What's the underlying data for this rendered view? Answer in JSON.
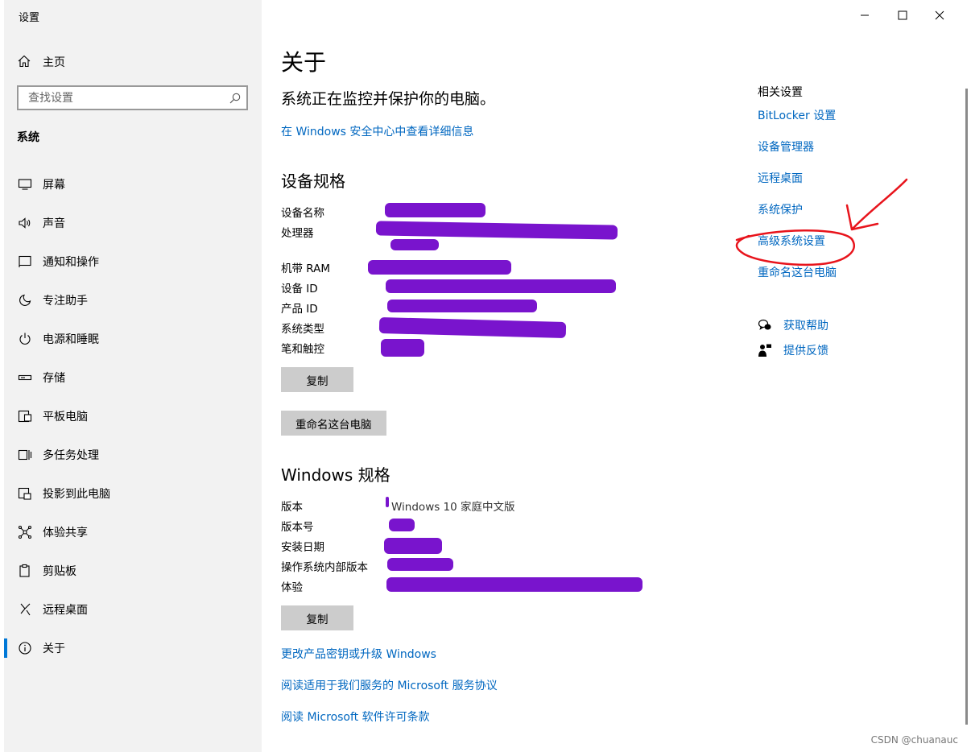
{
  "window": {
    "title": "设置"
  },
  "sidebar": {
    "home_label": "主页",
    "search_placeholder": "查找设置",
    "section_title": "系统",
    "items": [
      {
        "label": "屏幕",
        "icon": "display-icon"
      },
      {
        "label": "声音",
        "icon": "speaker-icon"
      },
      {
        "label": "通知和操作",
        "icon": "notification-icon"
      },
      {
        "label": "专注助手",
        "icon": "moon-icon"
      },
      {
        "label": "电源和睡眠",
        "icon": "power-icon"
      },
      {
        "label": "存储",
        "icon": "storage-icon"
      },
      {
        "label": "平板电脑",
        "icon": "tablet-icon"
      },
      {
        "label": "多任务处理",
        "icon": "multitask-icon"
      },
      {
        "label": "投影到此电脑",
        "icon": "projection-icon"
      },
      {
        "label": "体验共享",
        "icon": "share-icon"
      },
      {
        "label": "剪贴板",
        "icon": "clipboard-icon"
      },
      {
        "label": "远程桌面",
        "icon": "remote-icon"
      },
      {
        "label": "关于",
        "icon": "info-icon",
        "active": true
      }
    ]
  },
  "main": {
    "title": "关于",
    "status_text": "系统正在监控并保护你的电脑。",
    "security_link": "在 Windows 安全中心中查看详细信息",
    "device_specs_title": "设备规格",
    "device_specs": [
      {
        "key": "设备名称"
      },
      {
        "key": "处理器"
      },
      {
        "key": "机带 RAM"
      },
      {
        "key": "设备 ID"
      },
      {
        "key": "产品 ID"
      },
      {
        "key": "系统类型"
      },
      {
        "key": "笔和触控"
      }
    ],
    "copy_button": "复制",
    "rename_button": "重命名这台电脑",
    "windows_specs_title": "Windows 规格",
    "windows_specs": [
      {
        "key": "版本",
        "value": "Windows 10 家庭中文版"
      },
      {
        "key": "版本号",
        "value": ""
      },
      {
        "key": "安装日期",
        "value": ""
      },
      {
        "key": "操作系统内部版本",
        "value": ""
      },
      {
        "key": "体验",
        "value": ""
      }
    ],
    "copy_button_2": "复制",
    "links": [
      "更改产品密钥或升级 Windows",
      "阅读适用于我们服务的 Microsoft 服务协议",
      "阅读 Microsoft 软件许可条款"
    ]
  },
  "related": {
    "title": "相关设置",
    "links": [
      "BitLocker 设置",
      "设备管理器",
      "远程桌面",
      "系统保护",
      "高级系统设置",
      "重命名这台电脑"
    ],
    "help_label": "获取帮助",
    "feedback_label": "提供反馈"
  },
  "watermark": "CSDN @chuanauc",
  "colors": {
    "accent": "#0067c0",
    "redaction": "#6e00c9",
    "annotation": "#e8141c"
  }
}
